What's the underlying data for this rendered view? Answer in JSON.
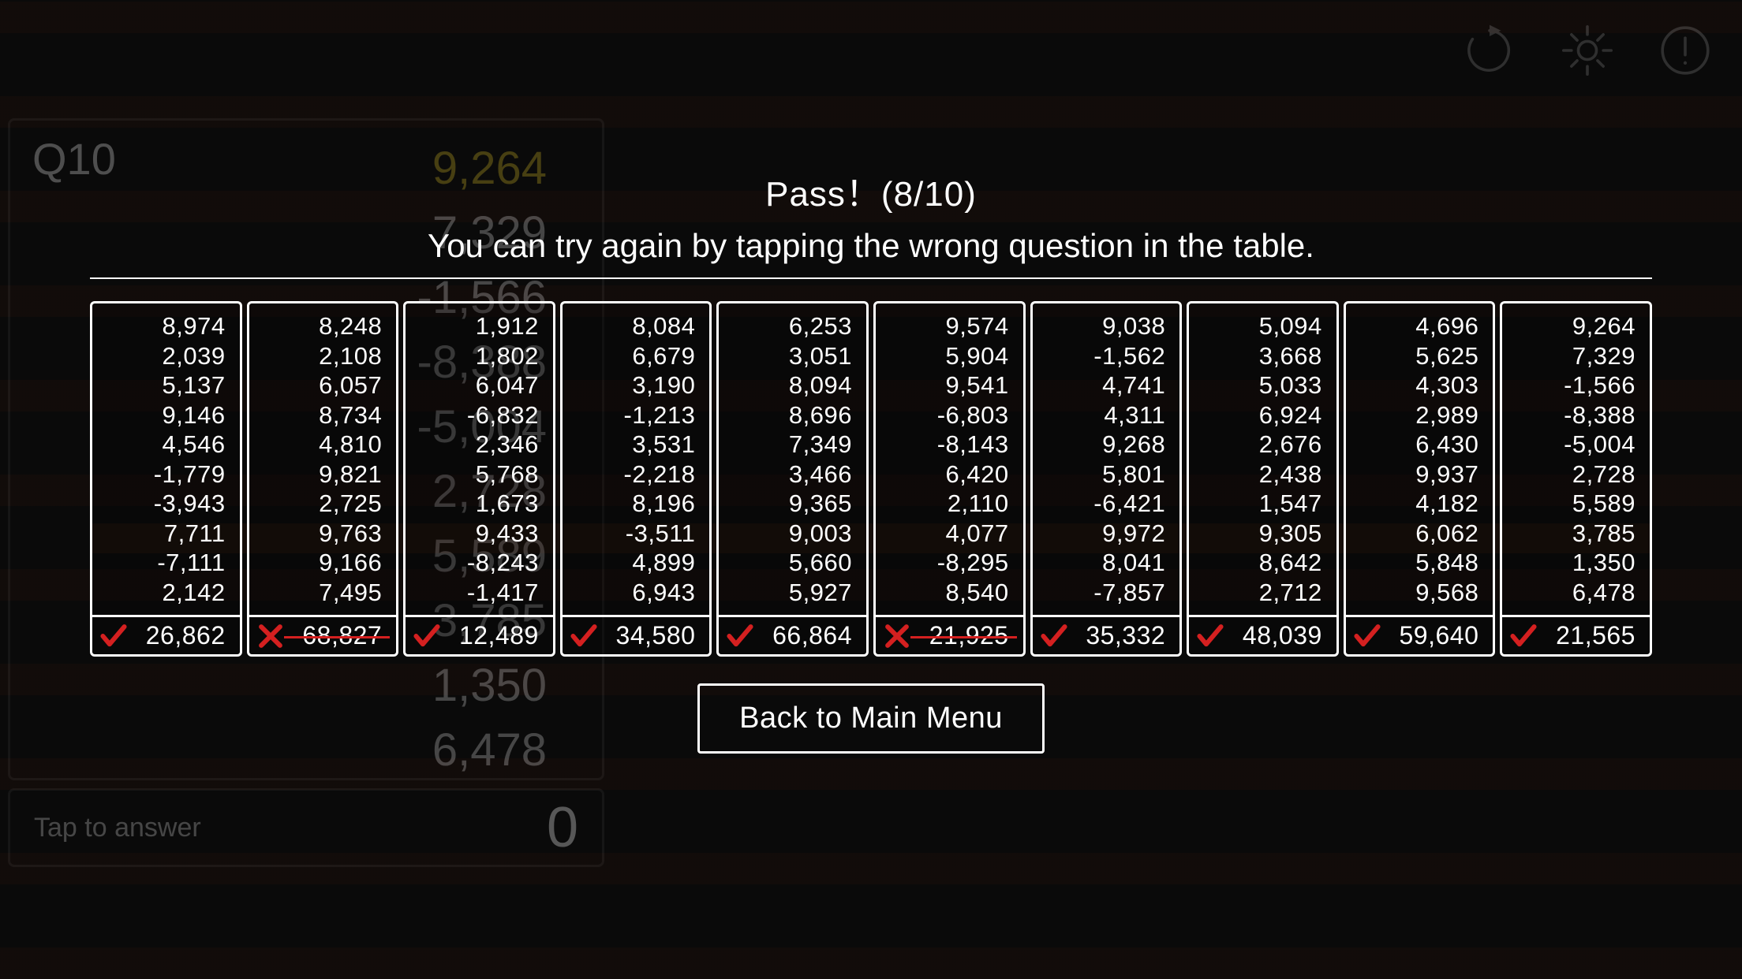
{
  "topIcons": [
    "refresh-icon",
    "gear-icon",
    "alert-icon"
  ],
  "qPanel": {
    "label": "Q10",
    "numbers": [
      "9,264",
      "7,329",
      "-1,566",
      "-8,388",
      "-5,004",
      "2,728",
      "5,589",
      "3,785",
      "1,350",
      "6,478"
    ]
  },
  "answerPanel": {
    "placeholder": "Tap to answer",
    "value": "0"
  },
  "result": {
    "title": "Pass！(8/10)",
    "subtitle": "You can try again by tapping the wrong question in the table."
  },
  "mainButton": "Back to Main Menu",
  "cards": [
    {
      "nums": [
        "8,974",
        "2,039",
        "5,137",
        "9,146",
        "4,546",
        "-1,779",
        "-3,943",
        "7,711",
        "-7,111",
        "2,142"
      ],
      "answer": "26,862",
      "correct": true
    },
    {
      "nums": [
        "8,248",
        "2,108",
        "6,057",
        "8,734",
        "4,810",
        "9,821",
        "2,725",
        "9,763",
        "9,166",
        "7,495"
      ],
      "answer": "68,827",
      "correct": false
    },
    {
      "nums": [
        "1,912",
        "1,802",
        "6,047",
        "-6,832",
        "2,346",
        "5,768",
        "1,673",
        "9,433",
        "-8,243",
        "-1,417"
      ],
      "answer": "12,489",
      "correct": true
    },
    {
      "nums": [
        "8,084",
        "6,679",
        "3,190",
        "-1,213",
        "3,531",
        "-2,218",
        "8,196",
        "-3,511",
        "4,899",
        "6,943"
      ],
      "answer": "34,580",
      "correct": true
    },
    {
      "nums": [
        "6,253",
        "3,051",
        "8,094",
        "8,696",
        "7,349",
        "3,466",
        "9,365",
        "9,003",
        "5,660",
        "5,927"
      ],
      "answer": "66,864",
      "correct": true
    },
    {
      "nums": [
        "9,574",
        "5,904",
        "9,541",
        "-6,803",
        "-8,143",
        "6,420",
        "2,110",
        "4,077",
        "-8,295",
        "8,540"
      ],
      "answer": "21,925",
      "correct": false
    },
    {
      "nums": [
        "9,038",
        "-1,562",
        "4,741",
        "4,311",
        "9,268",
        "5,801",
        "-6,421",
        "9,972",
        "8,041",
        "-7,857"
      ],
      "answer": "35,332",
      "correct": true
    },
    {
      "nums": [
        "5,094",
        "3,668",
        "5,033",
        "6,924",
        "2,676",
        "2,438",
        "1,547",
        "9,305",
        "8,642",
        "2,712"
      ],
      "answer": "48,039",
      "correct": true
    },
    {
      "nums": [
        "4,696",
        "5,625",
        "4,303",
        "2,989",
        "6,430",
        "9,937",
        "4,182",
        "6,062",
        "5,848",
        "9,568"
      ],
      "answer": "59,640",
      "correct": true
    },
    {
      "nums": [
        "9,264",
        "7,329",
        "-1,566",
        "-8,388",
        "-5,004",
        "2,728",
        "5,589",
        "3,785",
        "1,350",
        "6,478"
      ],
      "answer": "21,565",
      "correct": true
    }
  ]
}
